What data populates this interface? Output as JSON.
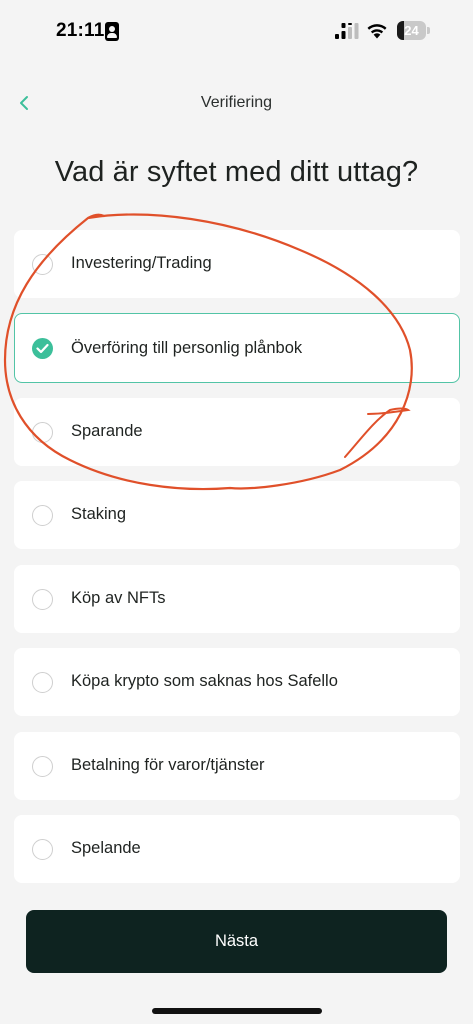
{
  "status_bar": {
    "time": "21:11",
    "battery_level": "24",
    "battery_fraction": 0.24
  },
  "header": {
    "title": "Verifiering",
    "back_icon": "chevron-left-icon"
  },
  "question": "Vad är syftet med ditt uttag?",
  "options": [
    {
      "label": "Investering/Trading",
      "selected": false
    },
    {
      "label": "Överföring till personlig plånbok",
      "selected": true
    },
    {
      "label": "Sparande",
      "selected": false
    },
    {
      "label": "Staking",
      "selected": false
    },
    {
      "label": "Köp av NFTs",
      "selected": false
    },
    {
      "label": "Köpa krypto som saknas hos Safello",
      "selected": false
    },
    {
      "label": "Betalning för varor/tjänster",
      "selected": false
    },
    {
      "label": "Spelande",
      "selected": false
    }
  ],
  "next_button_label": "Nästa",
  "colors": {
    "accent": "#3cbf9a",
    "selected_border": "#52c4a6",
    "button_bg": "#0e2320",
    "annotation": "#e0502a",
    "background": "#f4f4f4"
  }
}
